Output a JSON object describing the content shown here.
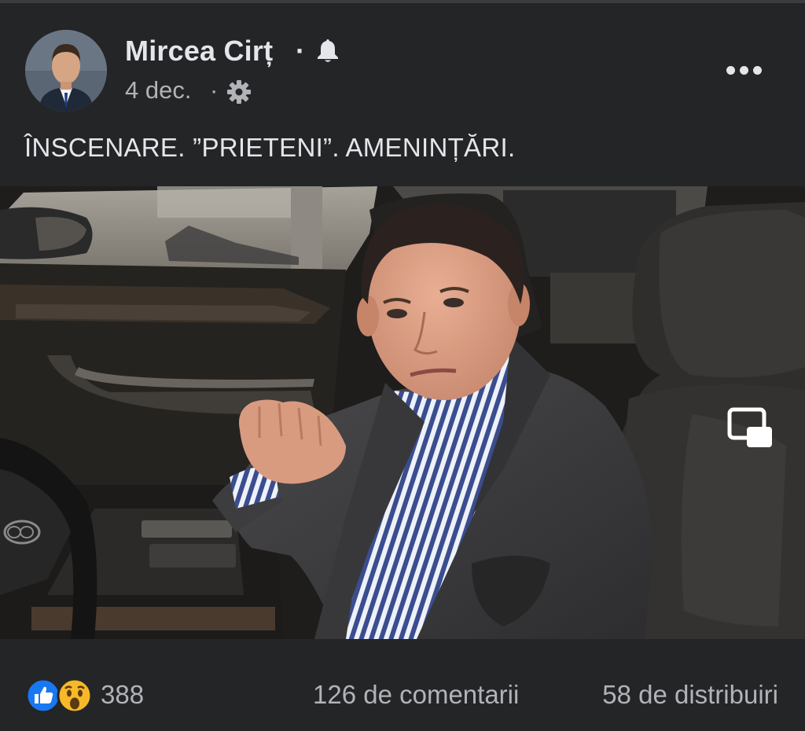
{
  "post": {
    "author": "Mircea Cirț",
    "name_separator": "·",
    "date": "4 dec.",
    "meta_separator": "·",
    "text": "ÎNSCENARE. ”PRIETENI”. AMENINȚĂRI.",
    "icons": {
      "notification": "bell-icon",
      "privacy": "gear-icon",
      "more": "more-horizontal-icon",
      "video_control": "picture-in-picture-icon",
      "reaction_1": "like-icon",
      "reaction_2": "wow-icon"
    }
  },
  "video": {
    "description_kind": "video-frame"
  },
  "footer": {
    "reactions_count": "388",
    "comments_count": "126 de comentarii",
    "shares_count": "58 de distribuiri"
  },
  "colors": {
    "background": "#242526",
    "primary_text": "#e4e6eb",
    "secondary_text": "#b0b3b8",
    "like_blue": "#1877f2",
    "wow_yellow": "#f7b928"
  }
}
